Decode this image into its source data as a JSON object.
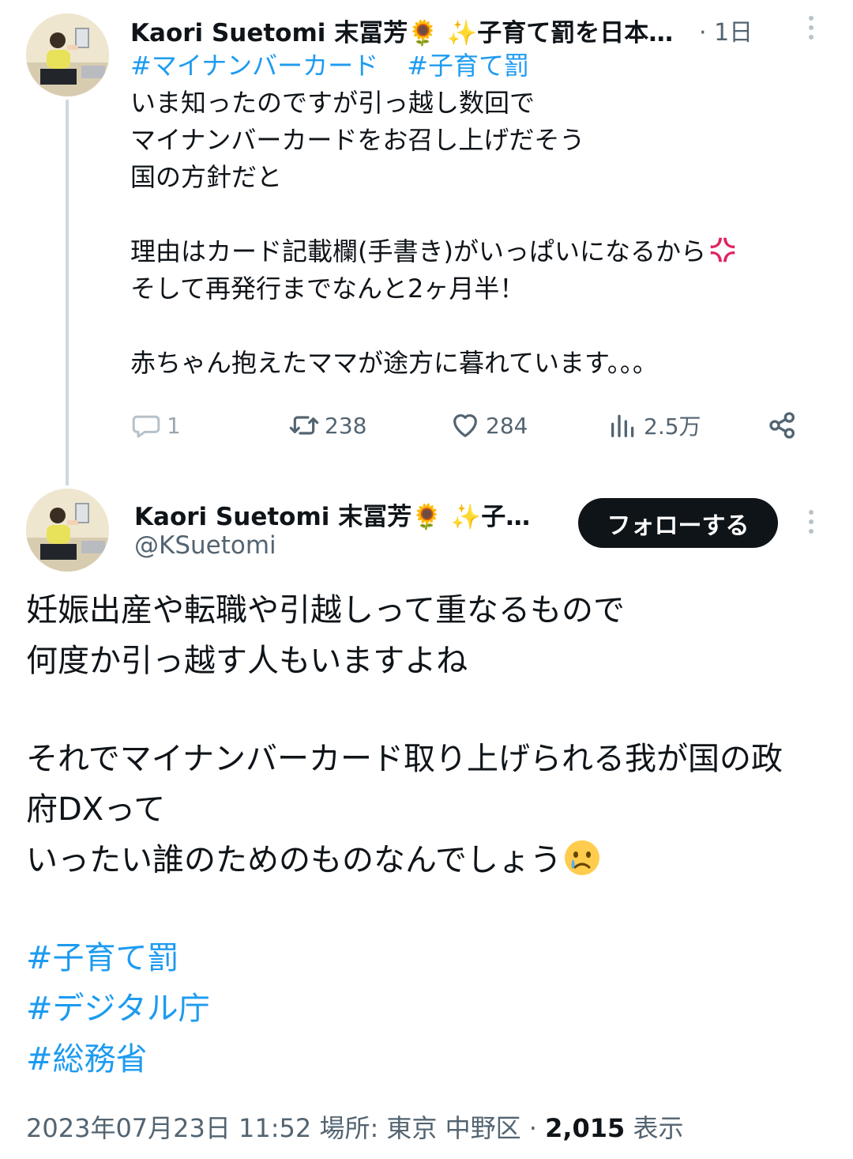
{
  "first_tweet": {
    "name": "Kaori Suetomi 末冨芳🌻 ✨子育て罰を日本からなくそう✨",
    "time": "· 1日",
    "hashtags": [
      "#マイナンバーカード",
      "#子育て罰"
    ],
    "lines": [
      "いま知ったのですが引っ越し数回で",
      "マイナンバーカードをお召し上げだそう",
      "国の方針だと",
      "",
      "理由はカード記載欄(手書き)がいっぱいになるから",
      "そして再発行までなんと2ヶ月半！",
      "",
      "赤ちゃん抱えたママが途方に暮れています。。。"
    ],
    "anger_emoji": "💢",
    "actions": {
      "replies": "1",
      "retweets": "238",
      "likes": "284",
      "views": "2.5万"
    }
  },
  "main_tweet": {
    "name": "Kaori Suetomi 末冨芳🌻 ✨子育て罰を日本からなくそう✨",
    "handle": "@KSuetomi",
    "follow_label": "フォローする",
    "lines": [
      "妊娠出産や転職や引越しって重なるもので",
      "何度か引っ越す人もいますよね",
      "",
      "それでマイナンバーカード取り上げられる我が国の政",
      "府DXって",
      "いったい誰のためのものなんでしょう"
    ],
    "cry_emoji": "😢",
    "hashtags": [
      "#子育て罰",
      "#デジタル庁",
      "#総務省"
    ],
    "timestamp": "2023年07月23日 11:52 場所: 東京 中野区",
    "separator": " · ",
    "views": "2,015",
    "views_label": " 表示"
  },
  "colors": {
    "accent": "#1d9bf0",
    "text": "#0f1419",
    "secondary": "#536471",
    "thread_line": "#cfd9de",
    "button_bg": "#0f1419"
  },
  "icons": [
    "avatar-photo",
    "reply-icon",
    "retweet-icon",
    "like-icon",
    "views-icon",
    "share-icon",
    "more-icon"
  ]
}
